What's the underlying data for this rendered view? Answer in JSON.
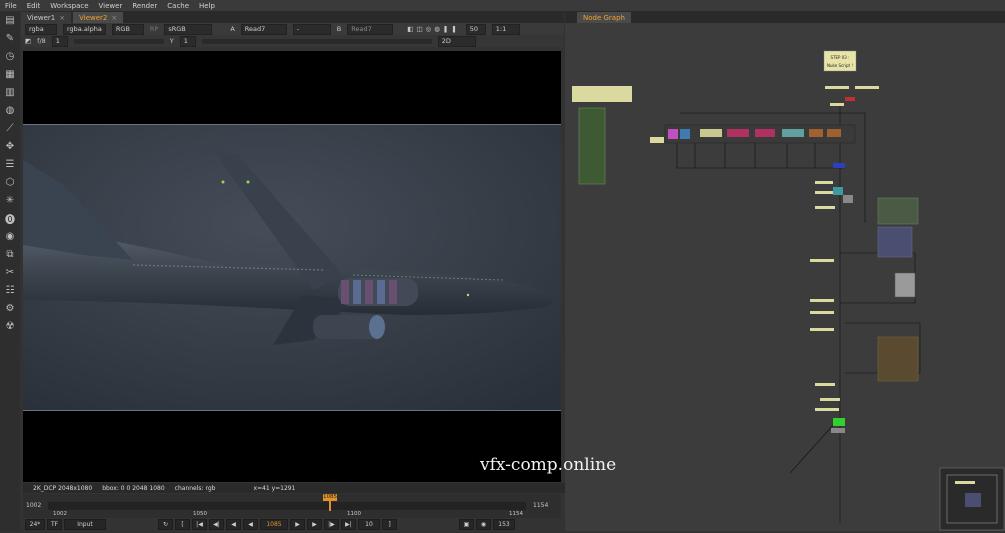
{
  "menu": [
    "File",
    "Edit",
    "Workspace",
    "Viewer",
    "Render",
    "Cache",
    "Help"
  ],
  "toolbar_icons": [
    "layout-icon",
    "brush-icon",
    "time-icon",
    "filter-icon",
    "channel-icon",
    "color-icon",
    "draw-icon",
    "transform-icon",
    "layers-icon",
    "3d-icon",
    "particles-icon",
    "keyer-icon",
    "eye-icon",
    "merge-icon",
    "tools-icon",
    "other-icon",
    "plugin-icon",
    "nuke-logo-icon"
  ],
  "viewer": {
    "tabs": [
      {
        "label": "Viewer1"
      },
      {
        "label": "Viewer2",
        "active": true
      }
    ],
    "row1": {
      "layer": "rgba",
      "alpha": "rgba.alpha",
      "channel": "RGB",
      "dim": "RP",
      "colorspace": "sRGB",
      "input_a_label": "A",
      "input_a": "Read7",
      "input_sep": "-",
      "input_b_label": "B",
      "input_b": "Read7",
      "zoom_pct": "50",
      "proxy": "1:1"
    },
    "row2": {
      "fstop": "f/8",
      "frame_field": "1",
      "y_label": "Y",
      "y_value": "1",
      "view_mode": "2D"
    },
    "info": {
      "format": "2K_DCP 2048x1080",
      "bbox": "bbox: 0 0 2048 1080",
      "channels": "channels: rgb",
      "coords": "x=41 y=1291"
    },
    "timeline": {
      "start": "1002",
      "end": "1154",
      "ticks": [
        "1002",
        "1050",
        "1100",
        "1154"
      ],
      "current": "1085",
      "range_end": "1154"
    },
    "transport": {
      "fps": "24*",
      "tf": "TF",
      "input": "Input",
      "frame": "1085",
      "step": "10",
      "end_frame": "153"
    }
  },
  "nodegraph": {
    "tab_label": "Node Graph",
    "backdrop_title": "STEP 03 :",
    "backdrop_subtitle": "Nuke Script !"
  },
  "watermark": "vfx-comp.online"
}
